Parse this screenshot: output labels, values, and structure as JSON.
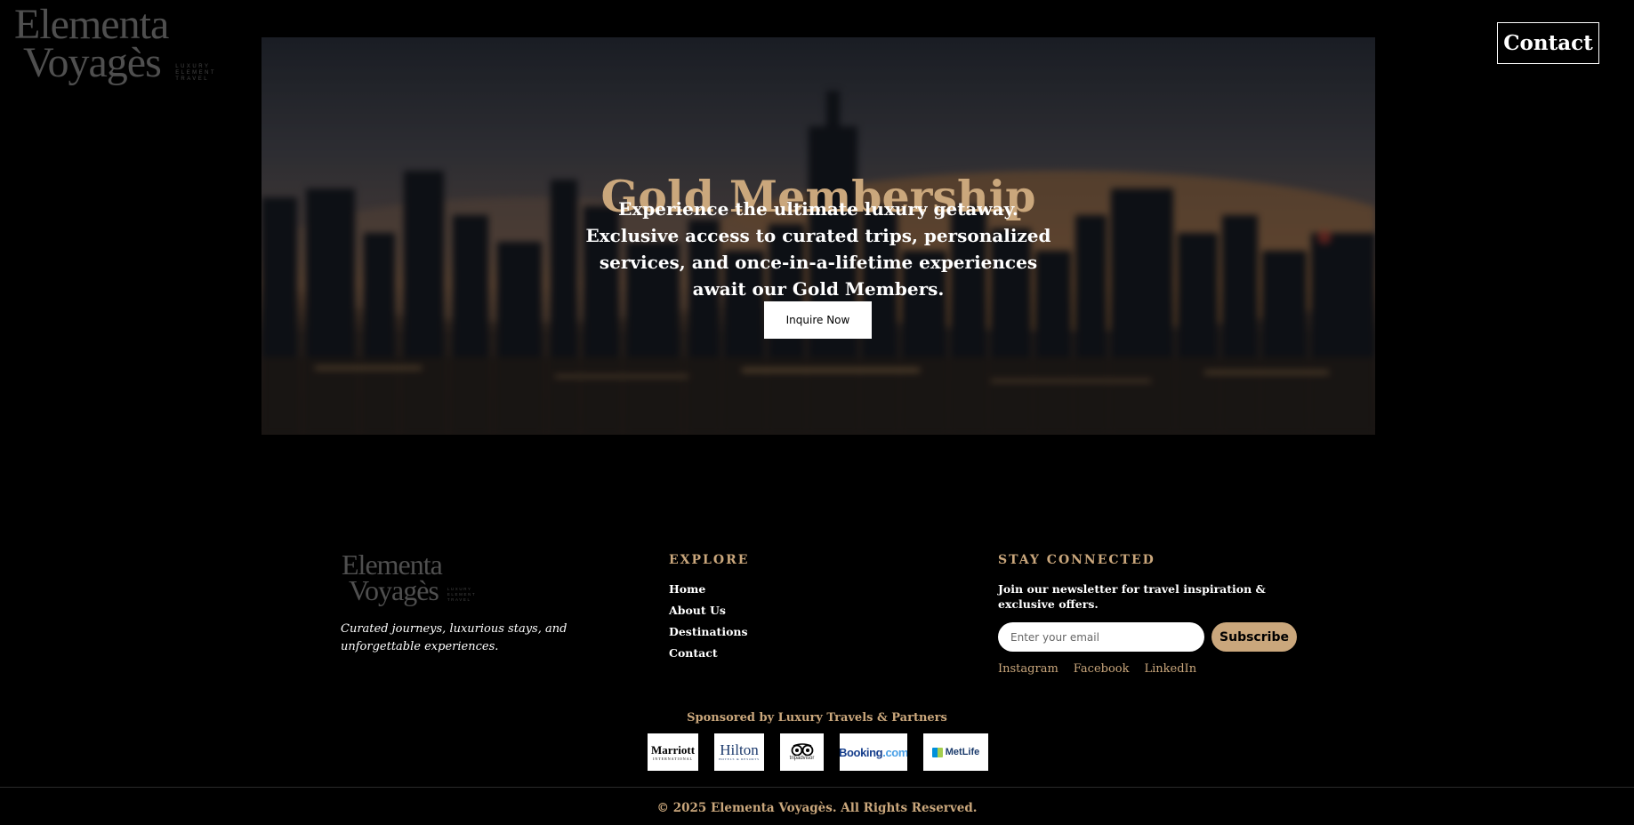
{
  "brand": {
    "line1": "Elementa",
    "line2": "Voyagès",
    "tag": [
      "LUXURY",
      "ELEMENT",
      "TRAVEL"
    ]
  },
  "header": {
    "contact_label": "Contact"
  },
  "hero": {
    "title": "Gold Membership",
    "text": "Experience the ultimate luxury getaway. Exclusive access to curated trips, personalized services, and once-in-a-lifetime experiences await our Gold Members.",
    "cta_label": "Inquire Now"
  },
  "footer": {
    "tagline": "Curated journeys, luxurious stays, and unforgettable experiences.",
    "explore": {
      "heading": "EXPLORE",
      "links": [
        "Home",
        "About Us",
        "Destinations",
        "Contact"
      ]
    },
    "newsletter": {
      "heading": "STAY CONNECTED",
      "text": "Join our newsletter for travel inspiration & exclusive offers.",
      "email_placeholder": "Enter your email",
      "subscribe_label": "Subscribe"
    },
    "social": [
      "Instagram",
      "Facebook",
      "LinkedIn"
    ],
    "sponsor_text": "Sponsored by Luxury Travels & Partners",
    "partners": [
      {
        "name": "Marriott",
        "sub": "INTERNATIONAL"
      },
      {
        "name": "Hilton",
        "sub": "HOTELS & RESORTS"
      },
      {
        "name": "tripadvisor"
      },
      {
        "name": "Booking",
        "suffix": ".com"
      },
      {
        "name": "MetLife"
      }
    ],
    "copyright": "© 2025 Elementa Voyagès. All Rights Reserved."
  },
  "colors": {
    "gold": "#caa77c",
    "background": "#000000"
  }
}
